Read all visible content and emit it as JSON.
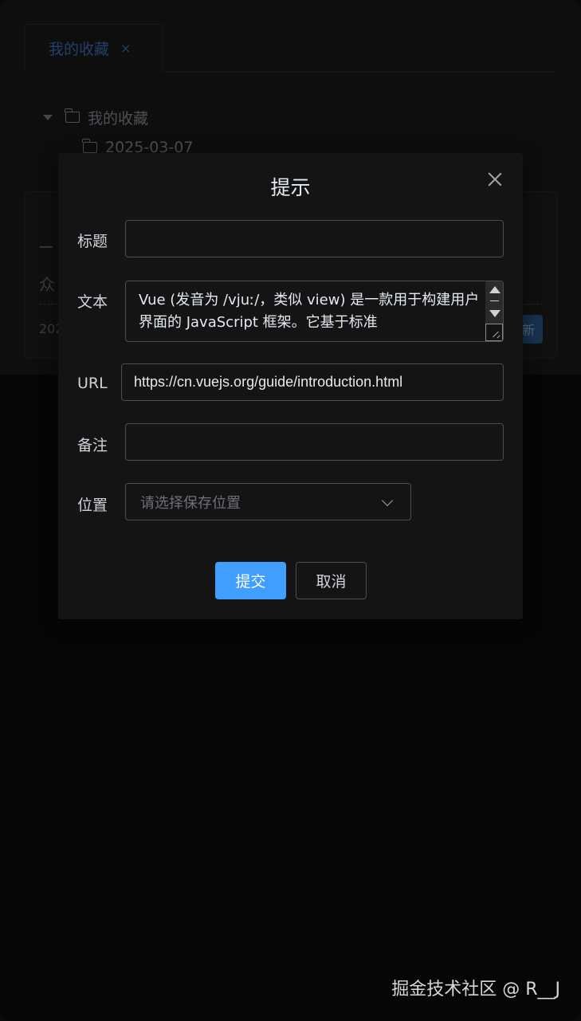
{
  "tabs": [
    {
      "label": "我的收藏",
      "close": "×"
    }
  ],
  "tree": {
    "root": "我的收藏",
    "child": "2025-03-07"
  },
  "card": {
    "dash": "—",
    "title": "众",
    "date": "202",
    "button": "新"
  },
  "dialog": {
    "title": "提示",
    "fields": {
      "title_label": "标题",
      "title_value": "",
      "text_label": "文本",
      "text_value": "Vue (发音为 /vjuː/，类似 view) 是一款用于构建用户界面的 JavaScript 框架。它基于标准",
      "url_label": "URL",
      "url_value": "https://cn.vuejs.org/guide/introduction.html",
      "note_label": "备注",
      "note_value": "",
      "location_label": "位置",
      "location_placeholder": "请选择保存位置"
    },
    "buttons": {
      "submit": "提交",
      "cancel": "取消"
    }
  },
  "watermark": "掘金技术社区 @ R__J",
  "colors": {
    "primary": "#409eff",
    "dialog_bg": "#141415",
    "border": "#4c4d4f"
  }
}
